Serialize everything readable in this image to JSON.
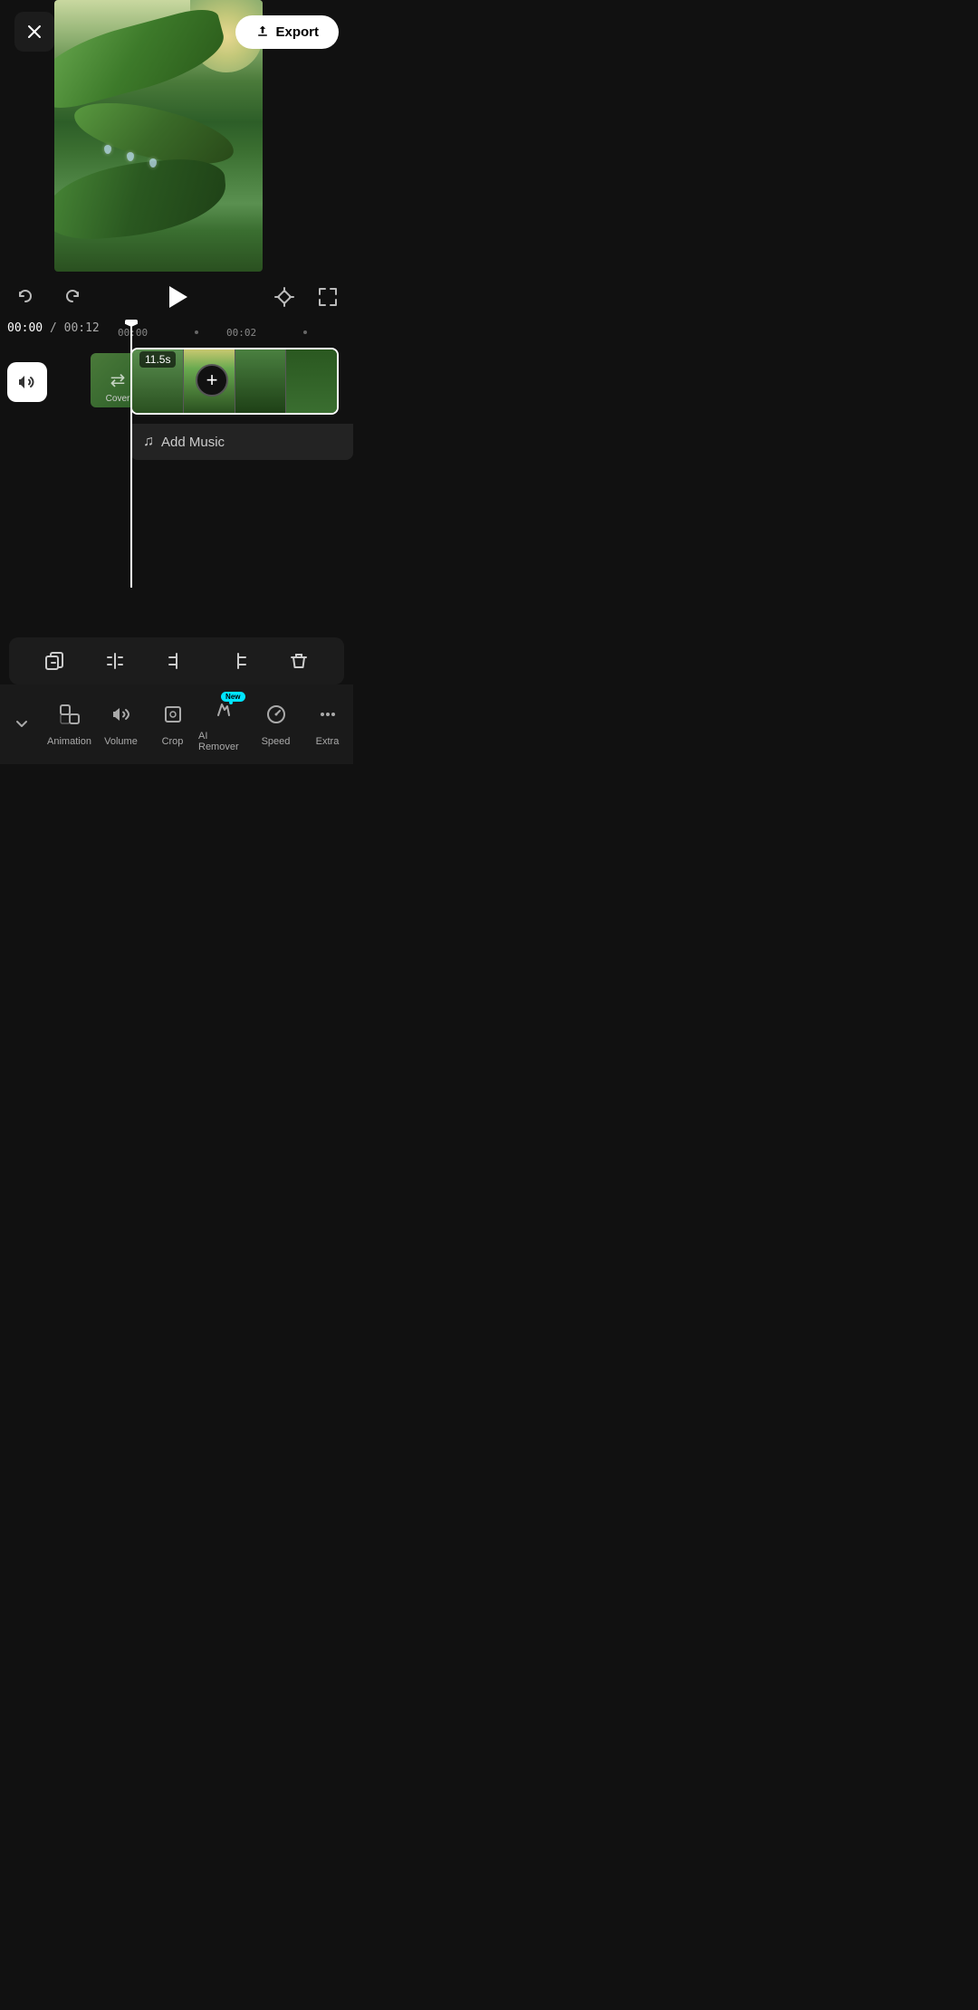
{
  "header": {
    "close_label": "✕",
    "export_label": "Export"
  },
  "controls": {
    "undo_icon": "↩",
    "redo_icon": "↪",
    "play_icon": "▶",
    "keyframe_icon": "◇",
    "fullscreen_icon": "⛶"
  },
  "timecode": {
    "current": "00:00",
    "separator": " / ",
    "total": "00:12"
  },
  "timeline": {
    "ruler": [
      {
        "label": "00:00",
        "dot": false
      },
      {
        "label": "",
        "dot": true
      },
      {
        "label": "00:02",
        "dot": false
      },
      {
        "label": "",
        "dot": true
      }
    ],
    "clip_duration": "11.5s",
    "add_music_label": "Add Music",
    "music_note": "♫"
  },
  "edit_toolbar": {
    "icons": [
      "⧉",
      "⊣⊢",
      "⊢⊣",
      "⊣⊣",
      "🗑"
    ]
  },
  "bottom_nav": {
    "collapse_icon": "⌄",
    "items": [
      {
        "id": "animation",
        "icon": "▣",
        "label": "Animation",
        "badge": null
      },
      {
        "id": "volume",
        "icon": "🔊",
        "label": "Volume",
        "badge": null
      },
      {
        "id": "crop",
        "icon": "⊡",
        "label": "Crop",
        "badge": null
      },
      {
        "id": "ai-remover",
        "icon": "✏",
        "label": "AI Remover",
        "badge": "New"
      },
      {
        "id": "speed",
        "icon": "◷",
        "label": "Speed",
        "badge": null
      },
      {
        "id": "extra",
        "icon": "…",
        "label": "Extra",
        "badge": null
      }
    ]
  }
}
